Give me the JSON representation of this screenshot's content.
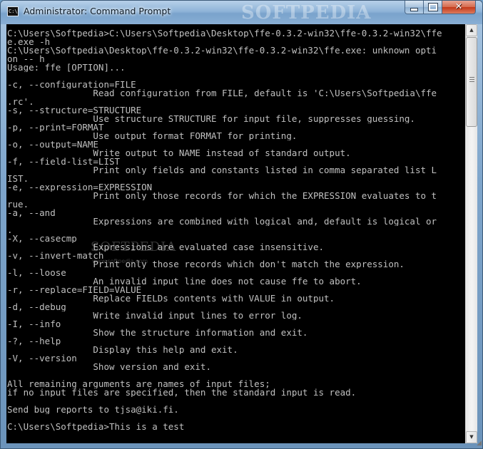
{
  "window": {
    "title": "Administrator: Command Prompt",
    "watermark": "SOFTPEDIA",
    "icon_label": "C:\\"
  },
  "controls": {
    "minimize_icon": "minimize-icon",
    "maximize_icon": "maximize-icon",
    "close_icon": "close-icon"
  },
  "console": {
    "watermark": "SOFTPEDIA",
    "watermark_sub": "www.softpedia.com",
    "lines": [
      "C:\\Users\\Softpedia>C:\\Users\\Softpedia\\Desktop\\ffe-0.3.2-win32\\ffe-0.3.2-win32\\ffe",
      "e.exe -h",
      "C:\\Users\\Softpedia\\Desktop\\ffe-0.3.2-win32\\ffe-0.3.2-win32\\ffe.exe: unknown opti",
      "on -- h",
      "Usage: ffe [OPTION]...",
      "",
      "-c, --configuration=FILE",
      "                Read configuration from FILE, default is 'C:\\Users\\Softpedia\\ffe",
      ".rc'.",
      "-s, --structure=STRUCTURE",
      "                Use structure STRUCTURE for input file, suppresses guessing.",
      "-p, --print=FORMAT",
      "                Use output format FORMAT for printing.",
      "-o, --output=NAME",
      "                Write output to NAME instead of standard output.",
      "-f, --field-list=LIST",
      "                Print only fields and constants listed in comma separated list L",
      "IST.",
      "-e, --expression=EXPRESSION",
      "                Print only those records for which the EXPRESSION evaluates to t",
      "rue.",
      "-a, --and",
      "                Expressions are combined with logical and, default is logical or",
      ".",
      "-X, --casecmp",
      "                Expressions are evaluated case insensitive.",
      "-v, --invert-match",
      "                Print only those records which don't match the expression.",
      "-l, --loose",
      "                An invalid input line does not cause ffe to abort.",
      "-r, --replace=FIELD=VALUE",
      "                Replace FIELDs contents with VALUE in output.",
      "-d, --debug",
      "                Write invalid input lines to error log.",
      "-I, --info",
      "                Show the structure information and exit.",
      "-?, --help",
      "                Display this help and exit.",
      "-V, --version",
      "                Show version and exit.",
      "",
      "All remaining arguments are names of input files;",
      "if no input files are specified, then the standard input is read.",
      "",
      "Send bug reports to tjsa@iki.fi.",
      "",
      "C:\\Users\\Softpedia>This is a test"
    ]
  },
  "scrollbar": {
    "up_icon": "scroll-up-icon",
    "down_icon": "scroll-down-icon"
  }
}
